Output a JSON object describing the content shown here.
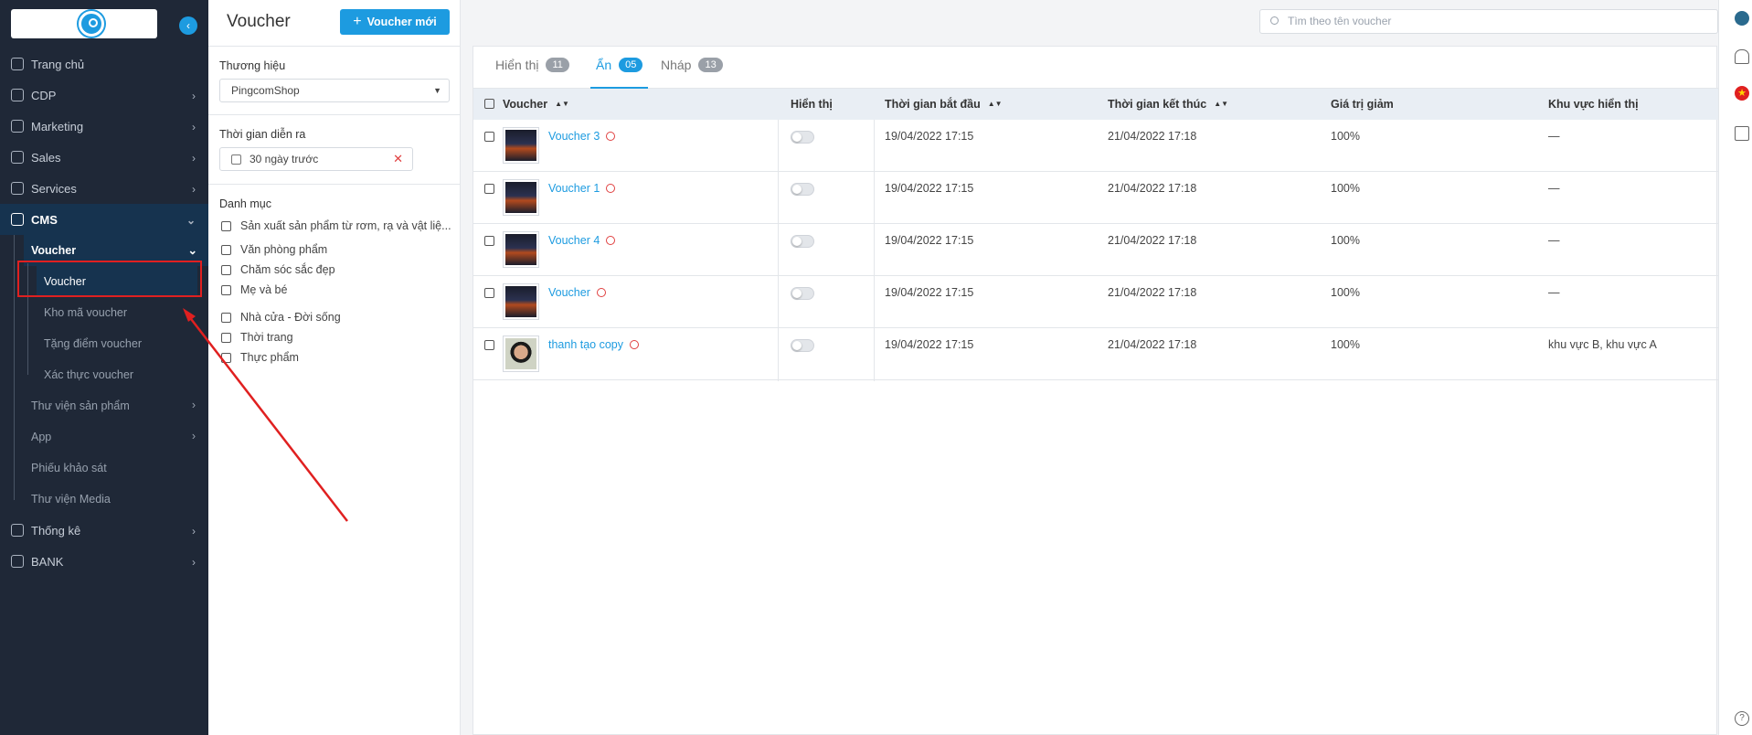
{
  "sidebar": {
    "items": [
      {
        "label": "Trang chủ",
        "icon": "home-icon",
        "has_children": false
      },
      {
        "label": "CDP",
        "icon": "user-icon",
        "has_children": true
      },
      {
        "label": "Marketing",
        "icon": "rocket-icon",
        "has_children": true
      },
      {
        "label": "Sales",
        "icon": "handshake-icon",
        "has_children": true
      },
      {
        "label": "Services",
        "icon": "services-icon",
        "has_children": true
      },
      {
        "label": "CMS",
        "icon": "cms-icon",
        "has_children": true,
        "active": true
      }
    ],
    "cms_children": {
      "voucher_group": "Voucher",
      "voucher_sub": [
        "Voucher",
        "Kho mã voucher",
        "Tặng điểm voucher",
        "Xác thực voucher"
      ],
      "others": [
        "Thư viện sản phẩm",
        "App",
        "Phiếu khảo sát",
        "Thư viện Media"
      ]
    },
    "bottom_items": [
      {
        "label": "Thống kê",
        "icon": "chart-icon"
      },
      {
        "label": "BANK",
        "icon": "bank-icon"
      }
    ]
  },
  "filters": {
    "page_title": "Voucher",
    "new_button": "Voucher mới",
    "brand_label": "Thương hiệu",
    "brand_value": "PingcomShop",
    "time_label": "Thời gian diễn ra",
    "time_value": "30 ngày trước",
    "category_label": "Danh mục",
    "categories": [
      "Sản xuất sản phẩm từ rơm, rạ và vật liệ...",
      "Văn phòng phẩm",
      "Chăm sóc sắc đẹp",
      "Mẹ và bé",
      "Nhà cửa - Đời sống",
      "Thời trang",
      "Thực phẩm"
    ]
  },
  "search": {
    "placeholder": "Tìm theo tên voucher"
  },
  "tabs": [
    {
      "label": "Hiển thị",
      "count": "11"
    },
    {
      "label": "Ẩn",
      "count": "05",
      "active": true
    },
    {
      "label": "Nháp",
      "count": "13"
    }
  ],
  "table": {
    "headers": {
      "voucher": "Voucher",
      "display": "Hiển thị",
      "start": "Thời gian bắt đầu",
      "end": "Thời gian kết thúc",
      "value": "Giá trị giảm",
      "area": "Khu vực hiển thị"
    },
    "rows": [
      {
        "name": "Voucher 3",
        "start": "19/04/2022 17:15",
        "end": "21/04/2022 17:18",
        "value": "100%",
        "area": "—",
        "thumb": "night"
      },
      {
        "name": "Voucher 1",
        "start": "19/04/2022 17:15",
        "end": "21/04/2022 17:18",
        "value": "100%",
        "area": "—",
        "thumb": "night"
      },
      {
        "name": "Voucher 4",
        "start": "19/04/2022 17:15",
        "end": "21/04/2022 17:18",
        "value": "100%",
        "area": "—",
        "thumb": "night"
      },
      {
        "name": "Voucher",
        "start": "19/04/2022 17:15",
        "end": "21/04/2022 17:18",
        "value": "100%",
        "area": "—",
        "thumb": "night"
      },
      {
        "name": "thanh tạo copy",
        "start": "19/04/2022 17:15",
        "end": "21/04/2022 17:18",
        "value": "100%",
        "area": "khu vực B, khu vực A",
        "thumb": "face"
      }
    ]
  },
  "colors": {
    "accent": "#1d9be0",
    "sidebar_bg": "#1f2837",
    "annotation": "#e02020"
  }
}
